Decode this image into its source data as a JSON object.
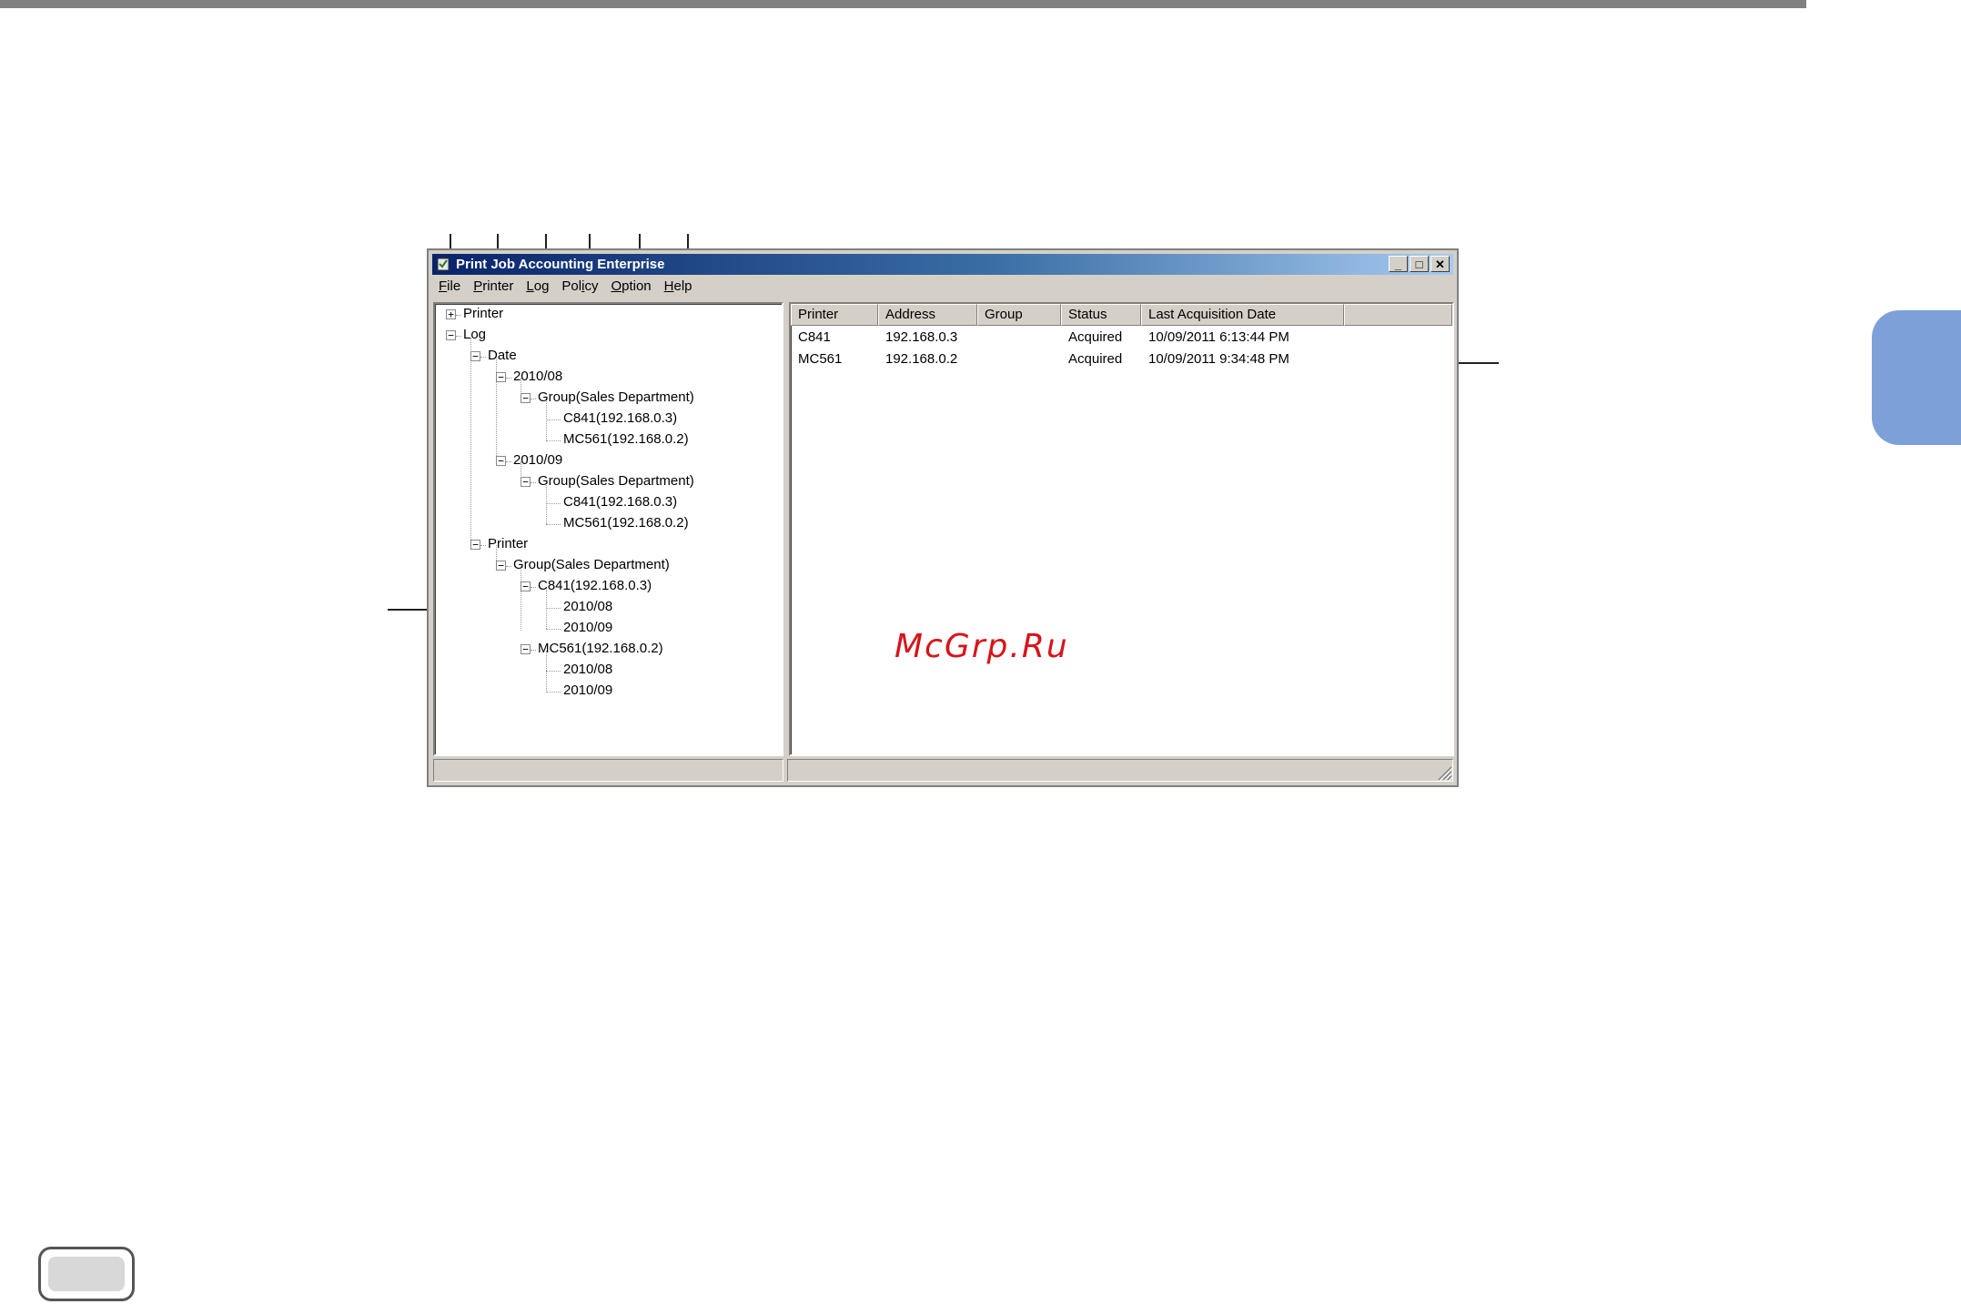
{
  "window": {
    "title": "Print Job Accounting Enterprise",
    "controls": {
      "minimize": "_",
      "maximize": "□",
      "close": "✕"
    }
  },
  "menu": [
    {
      "accel": "F",
      "rest": "ile"
    },
    {
      "accel": "P",
      "rest": "rinter"
    },
    {
      "accel": "L",
      "rest": "og"
    },
    {
      "accel": "P",
      "rest": "olicy",
      "pre": "Pol",
      "accel_mid": "i",
      "post": "cy"
    },
    {
      "accel": "O",
      "rest": "ption"
    },
    {
      "accel": "H",
      "rest": "elp"
    }
  ],
  "tree": {
    "printer_root": "Printer",
    "log_root": "Log",
    "date": "Date",
    "month_1": "2010/08",
    "group_1": "Group(Sales Department)",
    "c841_1": "C841(192.168.0.3)",
    "mc561_1": "MC561(192.168.0.2)",
    "month_2": "2010/09",
    "group_2": "Group(Sales Department)",
    "c841_2": "C841(192.168.0.3)",
    "mc561_2": "MC561(192.168.0.2)",
    "printer": "Printer",
    "group_3": "Group(Sales Department)",
    "c841_3": "C841(192.168.0.3)",
    "c841_m1": "2010/08",
    "c841_m2": "2010/09",
    "mc561_3": "MC561(192.168.0.2)",
    "mc561_m1": "2010/08",
    "mc561_m2": "2010/09"
  },
  "list": {
    "columns": [
      "Printer",
      "Address",
      "Group",
      "Status",
      "Last Acquisition Date"
    ],
    "rows": [
      {
        "printer": "C841",
        "address": "192.168.0.3",
        "group": "",
        "status": "Acquired",
        "date": "10/09/2011 6:13:44 PM"
      },
      {
        "printer": "MC561",
        "address": "192.168.0.2",
        "group": "",
        "status": "Acquired",
        "date": "10/09/2011 9:34:48 PM"
      }
    ]
  },
  "watermark": "McGrp.Ru",
  "colors": {
    "title_start": "#0a246a",
    "title_end": "#a6caf0",
    "tab": "#7da0d8",
    "watermark": "#d7141a"
  }
}
